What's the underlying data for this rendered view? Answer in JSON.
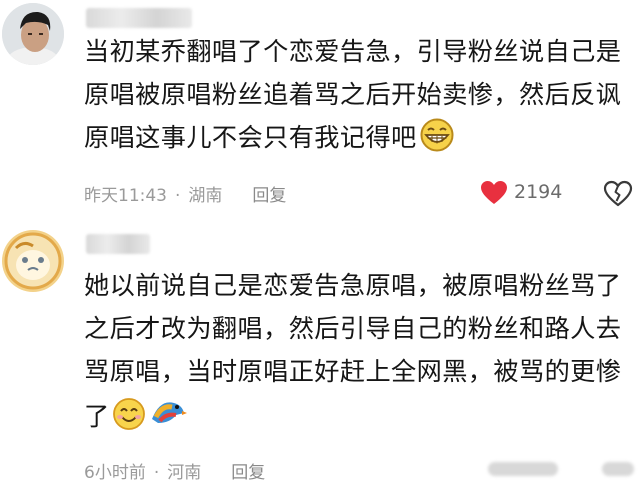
{
  "comments": [
    {
      "lines": [
        "当初某乔翻唱了个恋爱告急，引导粉丝说自己是",
        "原唱被原唱粉丝追着骂之后开始卖惨，然后反讽",
        "原唱这事儿不会只有我记得吧"
      ],
      "emoji": "grinning-face",
      "time": "昨天11:43",
      "location": "湖南",
      "reply_label": "回复",
      "like_count": "2194",
      "like_color": "#e8303f"
    },
    {
      "lines": [
        "她以前说自己是恋爱告急原唱，被原唱粉丝骂了",
        "之后才改为翻唱，然后引导自己的粉丝和路人去",
        "骂原唱，当时原唱正好赶上全网黑，被骂的更惨",
        "了"
      ],
      "emoji": "smiling-face",
      "emoji2": "colorful-bird-sticker",
      "time": "6小时前",
      "location": "河南",
      "reply_label": "回复"
    }
  ],
  "separator": "·"
}
